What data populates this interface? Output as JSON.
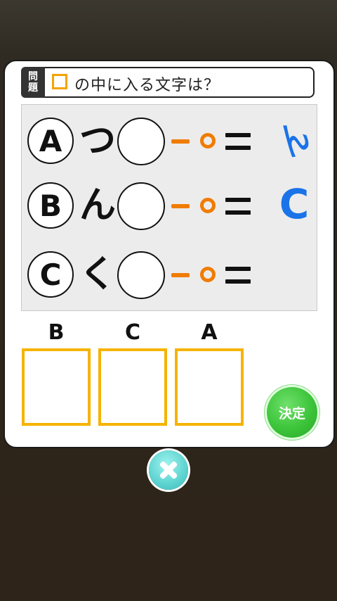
{
  "question": {
    "tag_top": "問",
    "tag_bottom": "題",
    "text": "の中に入る文字は？"
  },
  "rows": [
    {
      "letter": "A",
      "kana": "つ",
      "answer": "ん"
    },
    {
      "letter": "B",
      "kana": "ん",
      "answer": "C"
    },
    {
      "letter": "C",
      "kana": "く",
      "answer": ""
    }
  ],
  "slots": {
    "labels": [
      "B",
      "C",
      "A"
    ]
  },
  "buttons": {
    "decide_label": "決定"
  },
  "colors": {
    "accent_orange": "#f07c00",
    "slot_border": "#f5b300",
    "answer_blue": "#1a73e8",
    "decide_green": "#3cc43a",
    "close_teal": "#5cd3d0"
  }
}
